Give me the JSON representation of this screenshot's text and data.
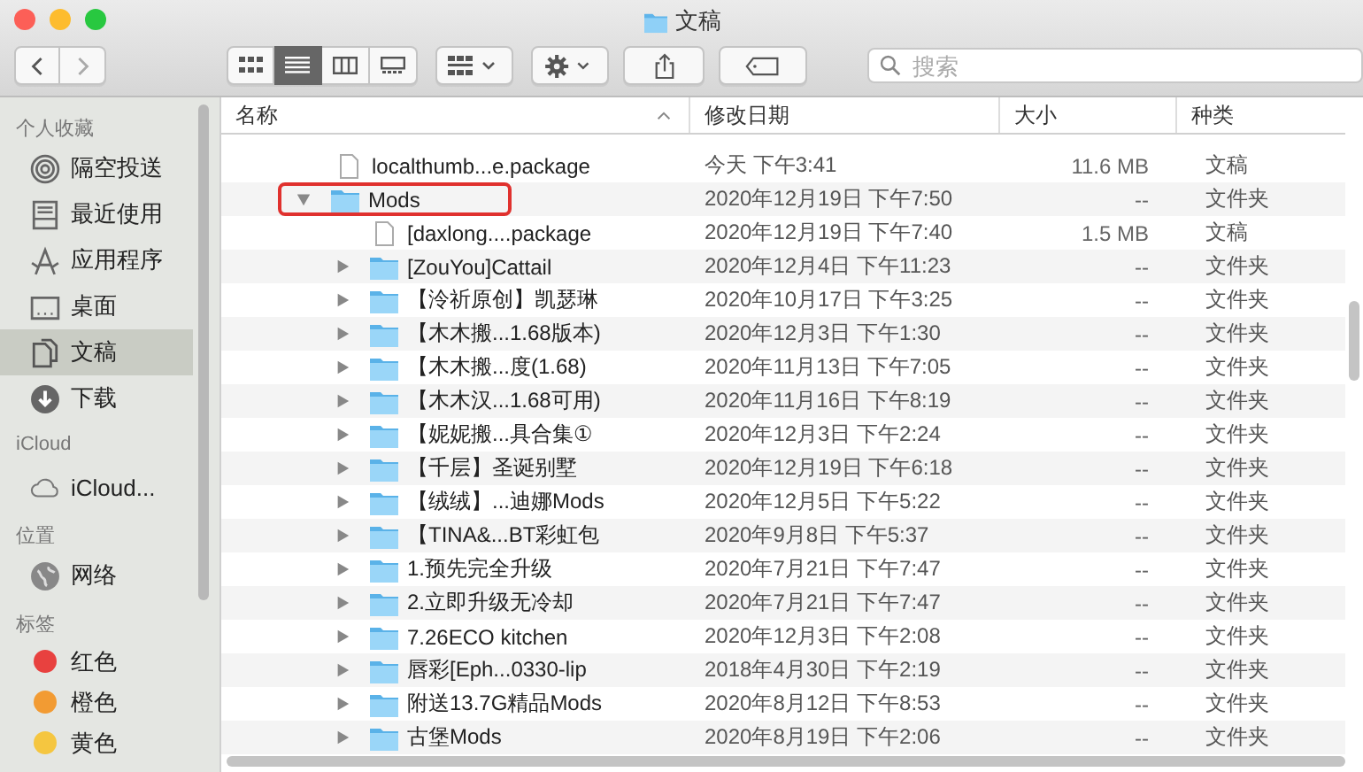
{
  "window": {
    "title": "文稿"
  },
  "toolbar": {
    "view_buttons": [
      {
        "kind": "icons",
        "selected": false
      },
      {
        "kind": "list",
        "selected": true
      },
      {
        "kind": "columns",
        "selected": false
      },
      {
        "kind": "gallery",
        "selected": false
      }
    ],
    "search": {
      "placeholder": "搜索"
    }
  },
  "sidebar": {
    "sections": [
      {
        "title": "个人收藏",
        "items": [
          {
            "label": "隔空投送",
            "kind": "airdrop",
            "selected": false
          },
          {
            "label": "最近使用",
            "kind": "recent",
            "selected": false
          },
          {
            "label": "应用程序",
            "kind": "apps",
            "selected": false
          },
          {
            "label": "桌面",
            "kind": "desktop",
            "selected": false
          },
          {
            "label": "文稿",
            "kind": "documents",
            "selected": true
          },
          {
            "label": "下载",
            "kind": "downloads",
            "selected": false
          }
        ]
      },
      {
        "title": "iCloud",
        "items": [
          {
            "label": "iCloud...",
            "kind": "cloud",
            "selected": false
          }
        ]
      },
      {
        "title": "位置",
        "items": [
          {
            "label": "网络",
            "kind": "network",
            "selected": false
          }
        ]
      },
      {
        "title": "标签",
        "items": [
          {
            "label": "红色",
            "kind": "tag",
            "color": "#e8413f",
            "selected": false
          },
          {
            "label": "橙色",
            "kind": "tag",
            "color": "#f29b33",
            "selected": false
          },
          {
            "label": "黄色",
            "kind": "tag",
            "color": "#f5c640",
            "selected": false
          }
        ]
      }
    ]
  },
  "table": {
    "columns": [
      {
        "label": "名称",
        "sorted": true
      },
      {
        "label": "修改日期",
        "sorted": false
      },
      {
        "label": "大小",
        "sorted": false
      },
      {
        "label": "种类",
        "sorted": false
      }
    ],
    "rows": [
      {
        "kind": "file",
        "name": "localthumb...e.package",
        "date": "今天 下午3:41",
        "size": "11.6 MB",
        "type": "文稿"
      },
      {
        "kind": "folder",
        "name": "Mods",
        "date": "2020年12月19日 下午7:50",
        "size": "--",
        "type": "文件夹",
        "expanded": true,
        "highlighted": true,
        "children": [
          {
            "kind": "file",
            "name": "[daxlong....package",
            "date": "2020年12月19日 下午7:40",
            "size": "1.5 MB",
            "type": "文稿"
          },
          {
            "kind": "folder",
            "name": "[ZouYou]Cattail",
            "date": "2020年12月4日 下午11:23",
            "size": "--",
            "type": "文件夹",
            "expanded": false
          },
          {
            "kind": "folder",
            "name": "【泠祈原创】凯瑟琳",
            "date": "2020年10月17日 下午3:25",
            "size": "--",
            "type": "文件夹",
            "expanded": false
          },
          {
            "kind": "folder",
            "name": "【木木搬...1.68版本)",
            "date": "2020年12月3日 下午1:30",
            "size": "--",
            "type": "文件夹",
            "expanded": false
          },
          {
            "kind": "folder",
            "name": "【木木搬...度(1.68)",
            "date": "2020年11月13日 下午7:05",
            "size": "--",
            "type": "文件夹",
            "expanded": false
          },
          {
            "kind": "folder",
            "name": "【木木汉...1.68可用)",
            "date": "2020年11月16日 下午8:19",
            "size": "--",
            "type": "文件夹",
            "expanded": false
          },
          {
            "kind": "folder",
            "name": "【妮妮搬...具合集①",
            "date": "2020年12月3日 下午2:24",
            "size": "--",
            "type": "文件夹",
            "expanded": false
          },
          {
            "kind": "folder",
            "name": "【千层】圣诞别墅",
            "date": "2020年12月19日 下午6:18",
            "size": "--",
            "type": "文件夹",
            "expanded": false
          },
          {
            "kind": "folder",
            "name": "【绒绒】...迪娜Mods",
            "date": "2020年12月5日 下午5:22",
            "size": "--",
            "type": "文件夹",
            "expanded": false
          },
          {
            "kind": "folder",
            "name": "【TINA&...BT彩虹包",
            "date": "2020年9月8日 下午5:37",
            "size": "--",
            "type": "文件夹",
            "expanded": false
          },
          {
            "kind": "folder",
            "name": "1.预先完全升级",
            "date": "2020年7月21日 下午7:47",
            "size": "--",
            "type": "文件夹",
            "expanded": false
          },
          {
            "kind": "folder",
            "name": "2.立即升级无冷却",
            "date": "2020年7月21日 下午7:47",
            "size": "--",
            "type": "文件夹",
            "expanded": false
          },
          {
            "kind": "folder",
            "name": "7.26ECO kitchen",
            "date": "2020年12月3日 下午2:08",
            "size": "--",
            "type": "文件夹",
            "expanded": false
          },
          {
            "kind": "folder",
            "name": "唇彩[Eph...0330-lip",
            "date": "2018年4月30日 下午2:19",
            "size": "--",
            "type": "文件夹",
            "expanded": false
          },
          {
            "kind": "folder",
            "name": "附送13.7G精品Mods",
            "date": "2020年8月12日 下午8:53",
            "size": "--",
            "type": "文件夹",
            "expanded": false
          },
          {
            "kind": "folder",
            "name": "古堡Mods",
            "date": "2020年8月19日 下午2:06",
            "size": "--",
            "type": "文件夹",
            "expanded": false
          }
        ]
      }
    ]
  }
}
